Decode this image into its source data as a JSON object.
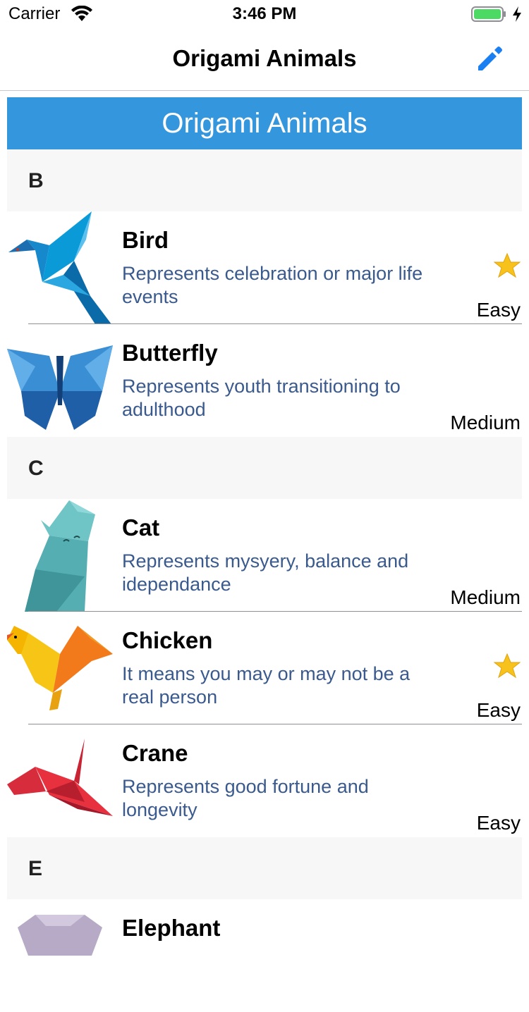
{
  "status_bar": {
    "carrier": "Carrier",
    "time": "3:46 PM",
    "battery_color": "#4cd964"
  },
  "nav": {
    "title": "Origami Animals",
    "edit_icon": "pencil-icon",
    "accent_color": "#1a7ff0"
  },
  "banner": {
    "title": "Origami Animals",
    "color": "#3496dc"
  },
  "sections": [
    {
      "letter": "B",
      "items": [
        {
          "name": "Bird",
          "description": "Represents celebration or major life events",
          "difficulty": "Easy",
          "favorite": true
        },
        {
          "name": "Butterfly",
          "description": "Represents youth transitioning to adulthood",
          "difficulty": "Medium",
          "favorite": false
        }
      ]
    },
    {
      "letter": "C",
      "items": [
        {
          "name": "Cat",
          "description": "Represents mysyery, balance and idependance",
          "difficulty": "Medium",
          "favorite": false
        },
        {
          "name": "Chicken",
          "description": "It means you may or may not be a real person",
          "difficulty": "Easy",
          "favorite": true
        },
        {
          "name": "Crane",
          "description": "Represents good fortune and longevity",
          "difficulty": "Easy",
          "favorite": false
        }
      ]
    },
    {
      "letter": "E",
      "items": [
        {
          "name": "Elephant",
          "description": "",
          "difficulty": "",
          "favorite": false
        }
      ]
    }
  ]
}
